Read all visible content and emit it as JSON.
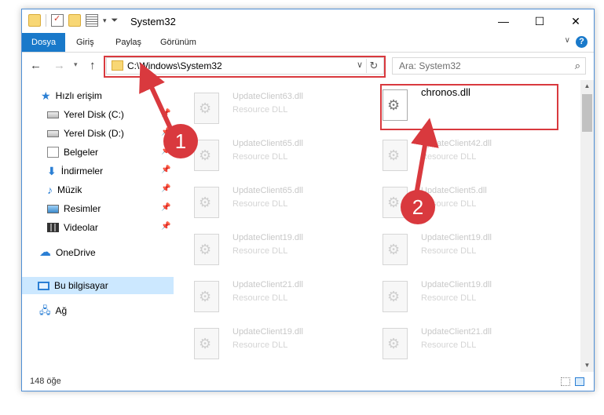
{
  "window": {
    "title": "System32"
  },
  "ribbon": {
    "tabs": [
      "Dosya",
      "Giriş",
      "Paylaş",
      "Görünüm"
    ],
    "help": "?"
  },
  "address": {
    "path": "C:\\Windows\\System32"
  },
  "search": {
    "placeholder": "Ara: System32"
  },
  "sidebar": {
    "items": [
      {
        "label": "Hızlı erişim",
        "icon": "star-icon"
      },
      {
        "label": "Yerel Disk (C:)",
        "icon": "drive-icon",
        "pinned": true
      },
      {
        "label": "Yerel Disk (D:)",
        "icon": "drive-icon",
        "pinned": true
      },
      {
        "label": "Belgeler",
        "icon": "documents-icon",
        "pinned": true
      },
      {
        "label": "İndirmeler",
        "icon": "download-icon",
        "pinned": true
      },
      {
        "label": "Müzik",
        "icon": "music-icon",
        "pinned": true
      },
      {
        "label": "Resimler",
        "icon": "pictures-icon",
        "pinned": true
      },
      {
        "label": "Videolar",
        "icon": "videos-icon",
        "pinned": true
      },
      {
        "label": "OneDrive",
        "icon": "cloud-icon"
      },
      {
        "label": "Bu bilgisayar",
        "icon": "computer-icon",
        "selected": true
      },
      {
        "label": "Ağ",
        "icon": "network-icon"
      }
    ]
  },
  "files": [
    {
      "name": "UpdateClient63.dll",
      "type": "Resource DLL"
    },
    {
      "name": "chronos.dll",
      "type": "",
      "selected": true
    },
    {
      "name": "UpdateClient65.dll",
      "type": "Resource DLL"
    },
    {
      "name": "UpdateClient42.dll",
      "type": "Resource DLL"
    },
    {
      "name": "UpdateClient65.dll",
      "type": "Resource DLL"
    },
    {
      "name": "UpdateClient5.dll",
      "type": "Resource DLL"
    },
    {
      "name": "UpdateClient19.dll",
      "type": "Resource DLL"
    },
    {
      "name": "UpdateClient19.dll",
      "type": "Resource DLL"
    },
    {
      "name": "UpdateClient21.dll",
      "type": "Resource DLL"
    },
    {
      "name": "UpdateClient19.dll",
      "type": "Resource DLL"
    },
    {
      "name": "UpdateClient19.dll",
      "type": "Resource DLL"
    },
    {
      "name": "UpdateClient21.dll",
      "type": "Resource DLL"
    }
  ],
  "status": {
    "count": "148 öğe"
  },
  "annotations": {
    "step1": "1",
    "step2": "2",
    "color": "#d9393e"
  }
}
